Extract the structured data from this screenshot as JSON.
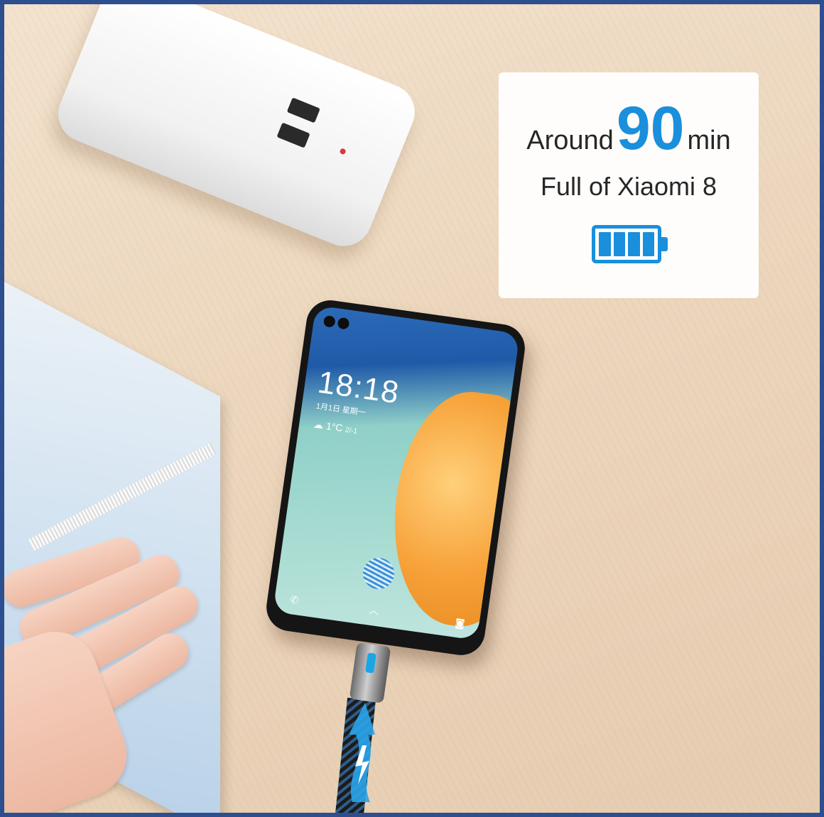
{
  "card": {
    "word_before": "Around",
    "number": "90",
    "unit": "min",
    "subtitle": "Full of Xiaomi 8"
  },
  "phone": {
    "time": "18:18",
    "date": "1月1日 星期一",
    "temperature": "1°C",
    "temp_range": "2/-1"
  },
  "colors": {
    "accent": "#1a8fdc",
    "frame": "#2d4f8f"
  },
  "icons": [
    "battery-full-icon",
    "charging-bolt-icon",
    "fingerprint-icon",
    "phone-call-icon",
    "camera-icon"
  ]
}
